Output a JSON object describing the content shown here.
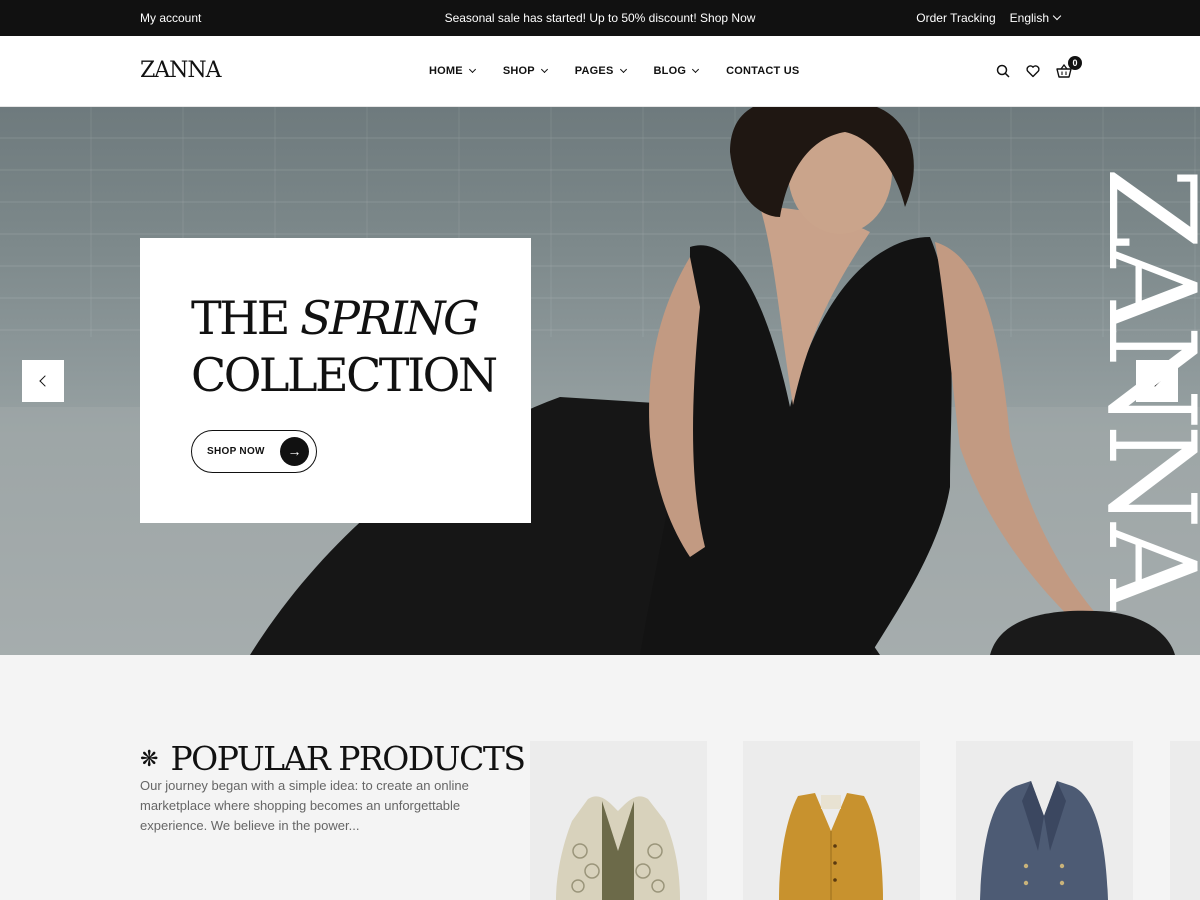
{
  "topbar": {
    "account": "My account",
    "promo": "Seasonal sale has started! Up to 50% discount! Shop Now",
    "tracking": "Order Tracking",
    "language": "English"
  },
  "header": {
    "logo": "ZANNA",
    "nav": [
      "HOME",
      "SHOP",
      "PAGES",
      "BLOG",
      "CONTACT US"
    ],
    "cart_count": "0"
  },
  "hero": {
    "title_line1": "THE",
    "title_italic": "SPRING",
    "title_line2": "COLLECTION",
    "button_label": "SHOP NOW",
    "vertical_brand": "ZANNA"
  },
  "popular": {
    "title": "POPULAR PRODUCTS",
    "description": "Our journey began with a simple idea: to create an online marketplace where shopping becomes an unforgettable experience. We believe in the power..."
  },
  "icons": {
    "search": "search-icon",
    "wishlist": "heart-icon",
    "cart": "basket-icon",
    "prev": "chevron-left-icon",
    "next": "chevron-right-icon",
    "shop_arrow": "arrow-right-icon"
  }
}
